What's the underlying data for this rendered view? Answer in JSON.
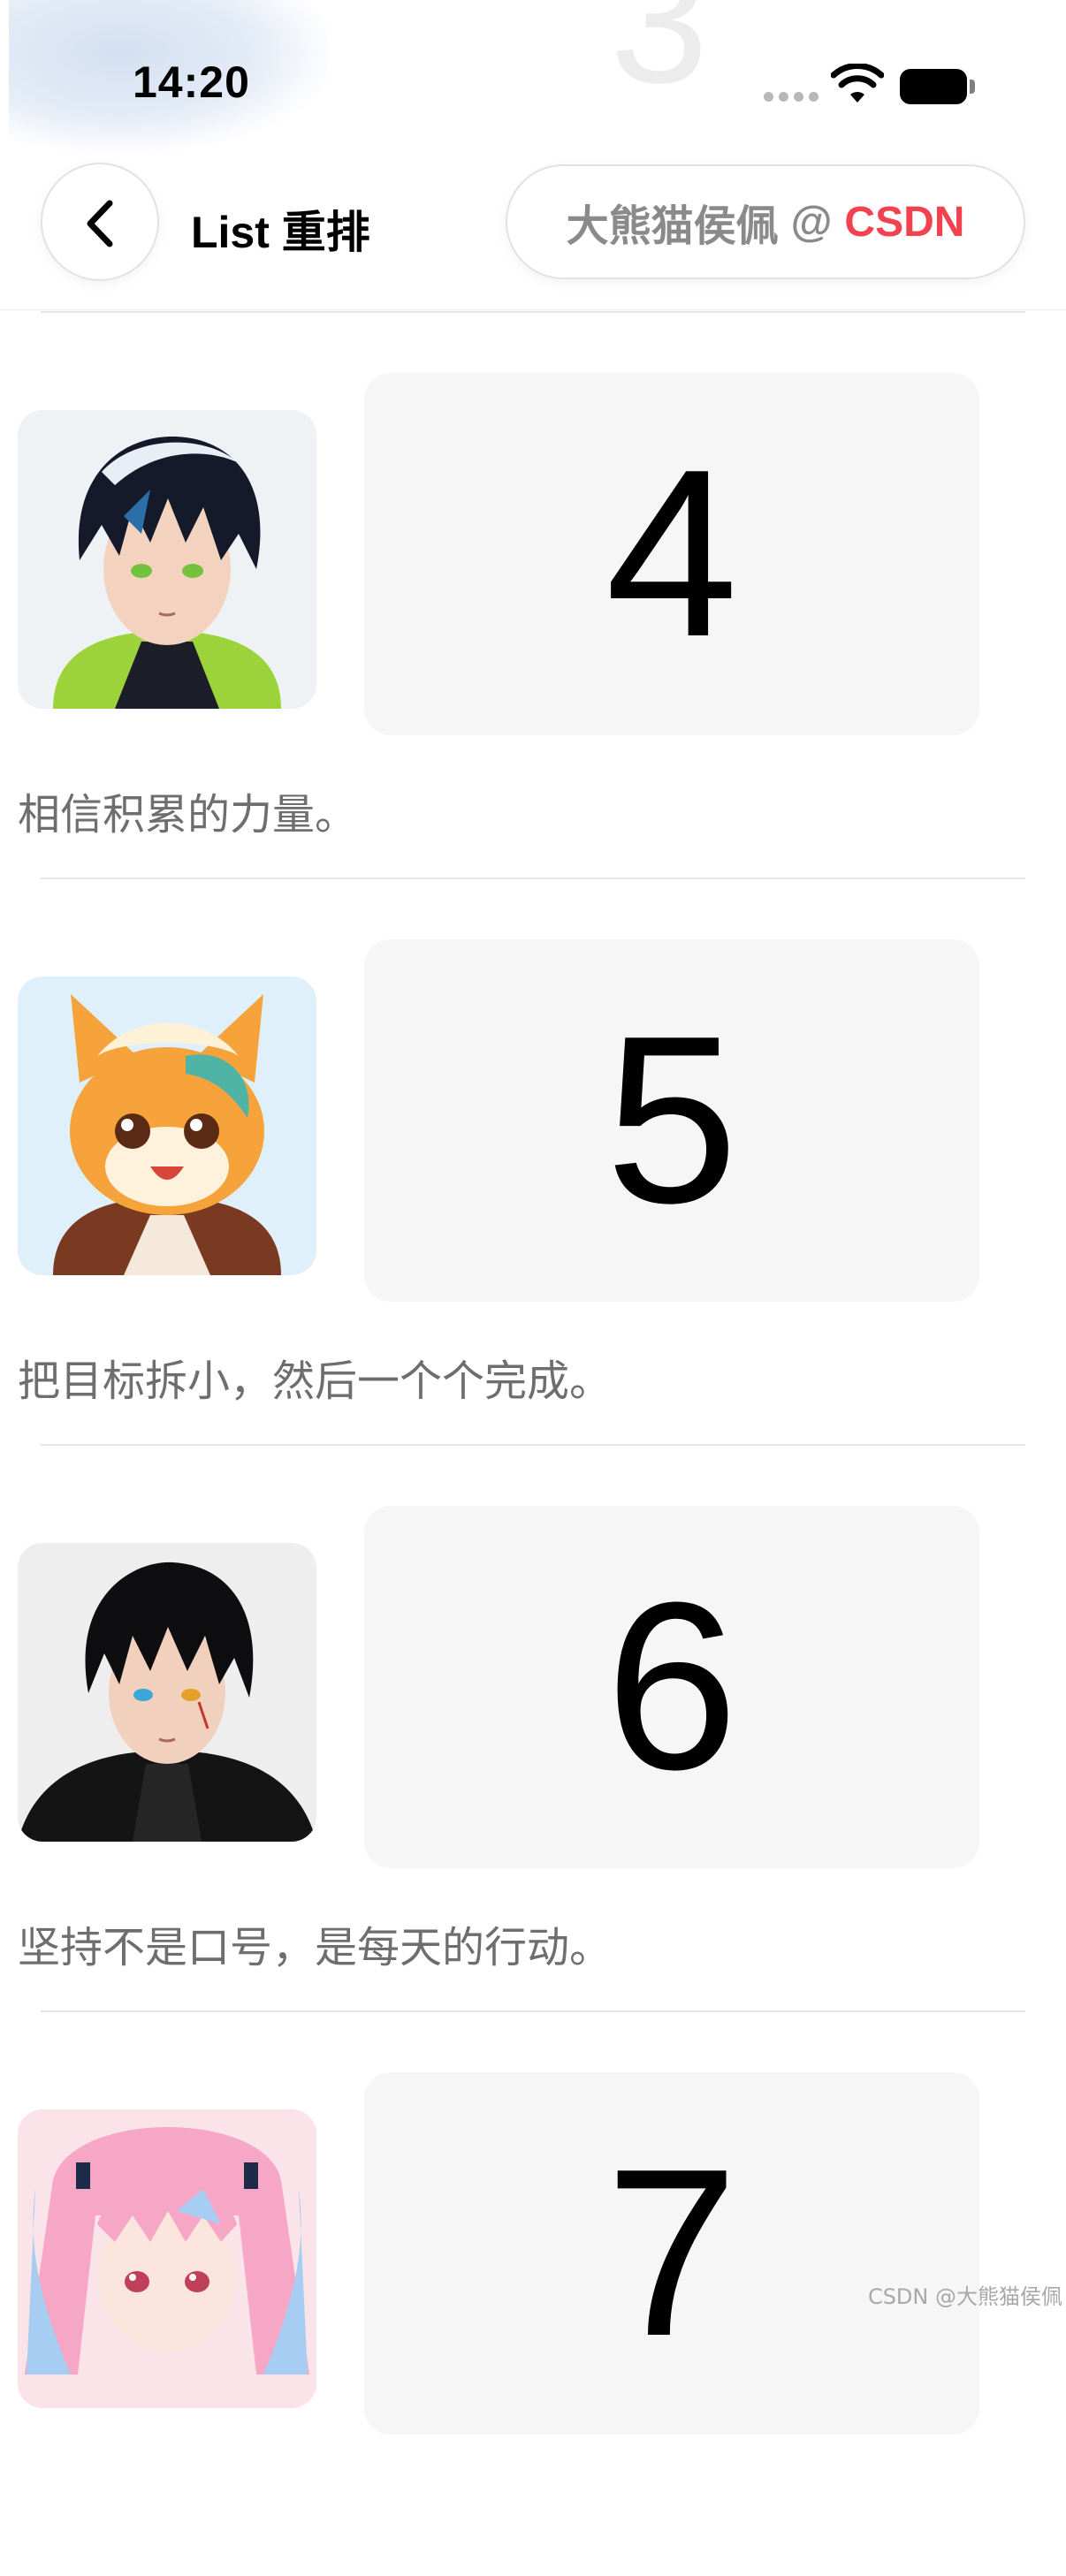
{
  "status_bar": {
    "time": "14:20"
  },
  "nav": {
    "title": "List 重排",
    "badge": {
      "author": "大熊猫侯佩",
      "at": "@",
      "brand": "CSDN"
    }
  },
  "list": [
    {
      "number": "4",
      "quote": "相信积累的力量。",
      "avatar": "avatar-boy-green-hoodie"
    },
    {
      "number": "5",
      "quote": "把目标拆小，然后一个个完成。",
      "avatar": "avatar-cartoon-fox"
    },
    {
      "number": "6",
      "quote": "坚持不是口号，是每天的行动。",
      "avatar": "avatar-boy-black-coat"
    },
    {
      "number": "7",
      "quote": "",
      "avatar": "avatar-girl-pink-hair"
    }
  ],
  "watermark": "CSDN @大熊猫侯佩",
  "colors": {
    "brand_red": "#f2424f",
    "card_bg": "#f6f6f6",
    "text_gray": "#6e6e6e"
  }
}
